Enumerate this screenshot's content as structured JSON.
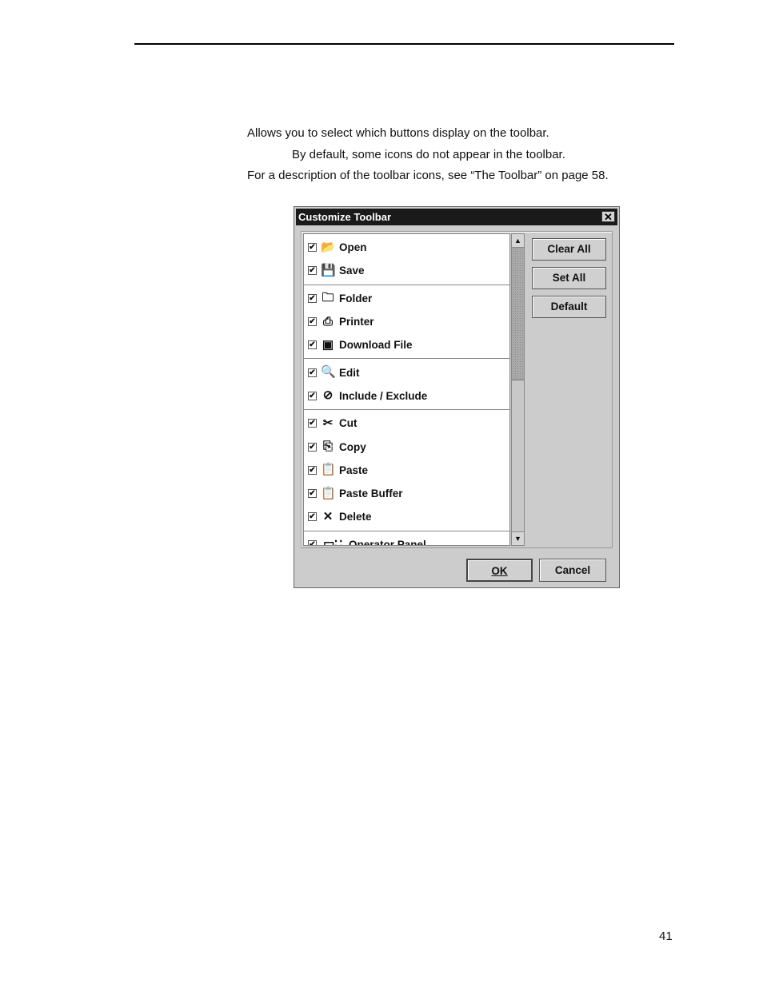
{
  "document": {
    "paragraphs": [
      "Allows you to select which buttons display on the toolbar.",
      "By default, some icons do not appear in the toolbar.",
      "For a description of the toolbar icons, see “The Toolbar” on page 58."
    ],
    "page_number": "41"
  },
  "dialog": {
    "title": "Customize Toolbar",
    "close_glyph": "✕",
    "groups": [
      {
        "items": [
          {
            "label": "Open",
            "icon": "open-folder-icon",
            "glyph": "📂",
            "checked": true
          },
          {
            "label": "Save",
            "icon": "save-disk-icon",
            "glyph": "💾",
            "checked": true
          }
        ]
      },
      {
        "items": [
          {
            "label": "Folder",
            "icon": "new-folder-icon",
            "glyph": "🗀",
            "checked": true
          },
          {
            "label": "Printer",
            "icon": "new-printer-icon",
            "glyph": "⎙",
            "checked": true
          },
          {
            "label": "Download File",
            "icon": "download-file-icon",
            "glyph": "▣",
            "checked": true
          }
        ]
      },
      {
        "items": [
          {
            "label": "Edit",
            "icon": "edit-magnifier-icon",
            "glyph": "🔍",
            "checked": true
          },
          {
            "label": "Include / Exclude",
            "icon": "prohibit-icon",
            "glyph": "⊘",
            "checked": true
          }
        ]
      },
      {
        "items": [
          {
            "label": "Cut",
            "icon": "scissors-icon",
            "glyph": "✂",
            "checked": true
          },
          {
            "label": "Copy",
            "icon": "copy-icon",
            "glyph": "⎘",
            "checked": true
          },
          {
            "label": "Paste",
            "icon": "paste-icon",
            "glyph": "📋",
            "checked": true
          },
          {
            "label": "Paste Buffer",
            "icon": "paste-buffer-icon",
            "glyph": "📋",
            "checked": true
          },
          {
            "label": "Delete",
            "icon": "delete-x-icon",
            "glyph": "✕",
            "checked": true
          }
        ]
      },
      {
        "items": [
          {
            "label": "Operator Panel",
            "icon": "operator-panel-icon",
            "glyph": "▭∷",
            "checked": true
          }
        ]
      }
    ],
    "check_glyph": "✔",
    "scroll_up_glyph": "▲",
    "scroll_down_glyph": "▼",
    "buttons": {
      "clear_all": "Clear All",
      "set_all": "Set All",
      "default": "Default",
      "ok": "OK",
      "cancel": "Cancel"
    }
  }
}
